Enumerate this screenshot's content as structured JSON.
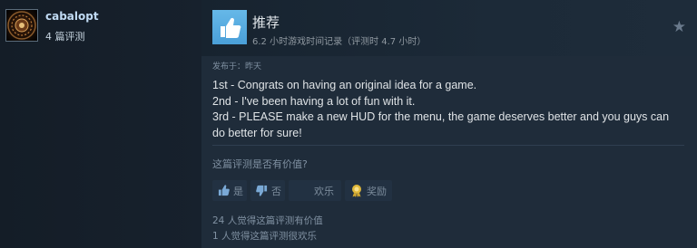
{
  "author": {
    "username": "cabalopt",
    "review_count": "4 篇评测"
  },
  "review": {
    "verdict": "推荐",
    "hours": "6.2 小时游戏时间记录（评测时 4.7 小时）",
    "posted": "发布于：昨天",
    "body_lines": [
      "1st - Congrats on having an original idea for a game.",
      "2nd - I've been having a lot of fun with it.",
      "3rd - PLEASE make a new HUD for the menu, the game deserves better and you guys can do better for sure!"
    ]
  },
  "feedback": {
    "question": "这篇评测是否有价值?",
    "yes_label": "是",
    "no_label": "否",
    "funny_label": "欢乐",
    "award_label": "奖励",
    "helpful_tally": "24 人觉得这篇评测有价值",
    "funny_tally": "1 人觉得这篇评测很欢乐"
  },
  "icons": {
    "thumb": "thumbs-up-icon",
    "star": "star-icon",
    "award": "award-medal-icon"
  },
  "colors": {
    "background": "#1b2838",
    "username": "#c1dbf4",
    "thumb_badge": "#5aaee3"
  }
}
